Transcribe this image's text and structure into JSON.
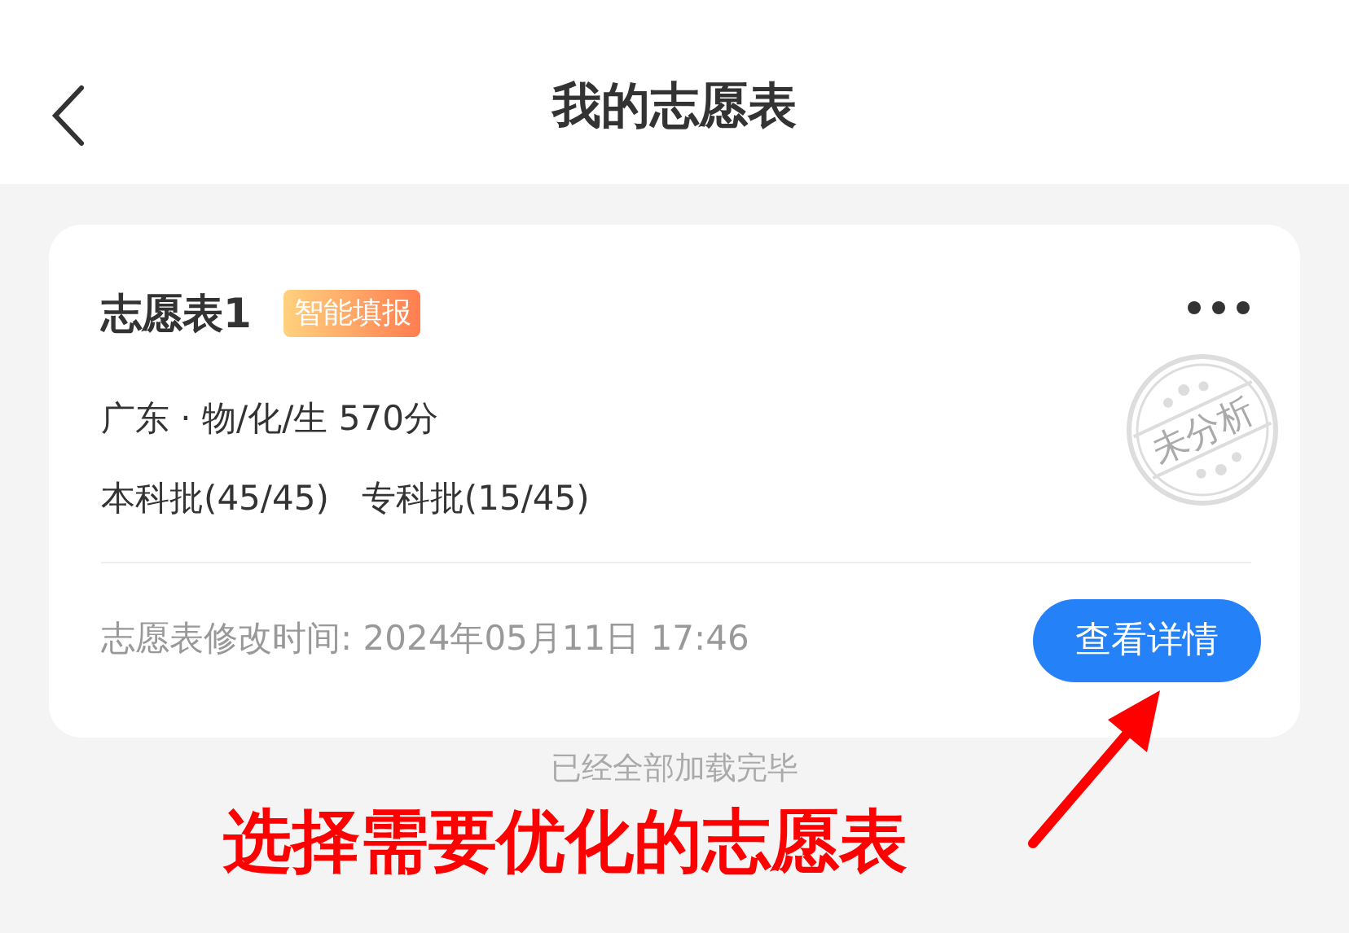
{
  "header": {
    "title": "我的志愿表"
  },
  "plan": {
    "title": "志愿表1",
    "tag": "智能填报",
    "stamp": "未分析",
    "lines": [
      "广东 · 物/化/生 570分",
      "本科批(45/45)   专科批(15/45)"
    ],
    "modified": "志愿表修改时间: 2024年05月11日 17:46",
    "button": "查看详情"
  },
  "footer_note": "已经全部加载完毕",
  "annotation": "选择需要优化的志愿表"
}
